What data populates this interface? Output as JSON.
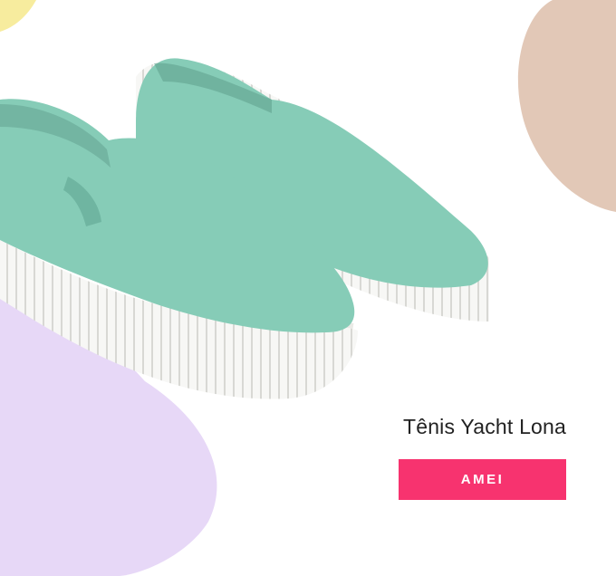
{
  "product": {
    "title": "Tênis Yacht Lona",
    "image_subject": "mint-green slip-on canvas sneakers"
  },
  "cta": {
    "label": "AMEI"
  },
  "colors": {
    "accent": "#f7336f",
    "shoe": "#86ccb7",
    "sole": "#f7f7f5",
    "blob_yellow": "#f7ec9e",
    "blob_peach": "#e2c8b7",
    "blob_lavender": "#e7d8f7"
  }
}
